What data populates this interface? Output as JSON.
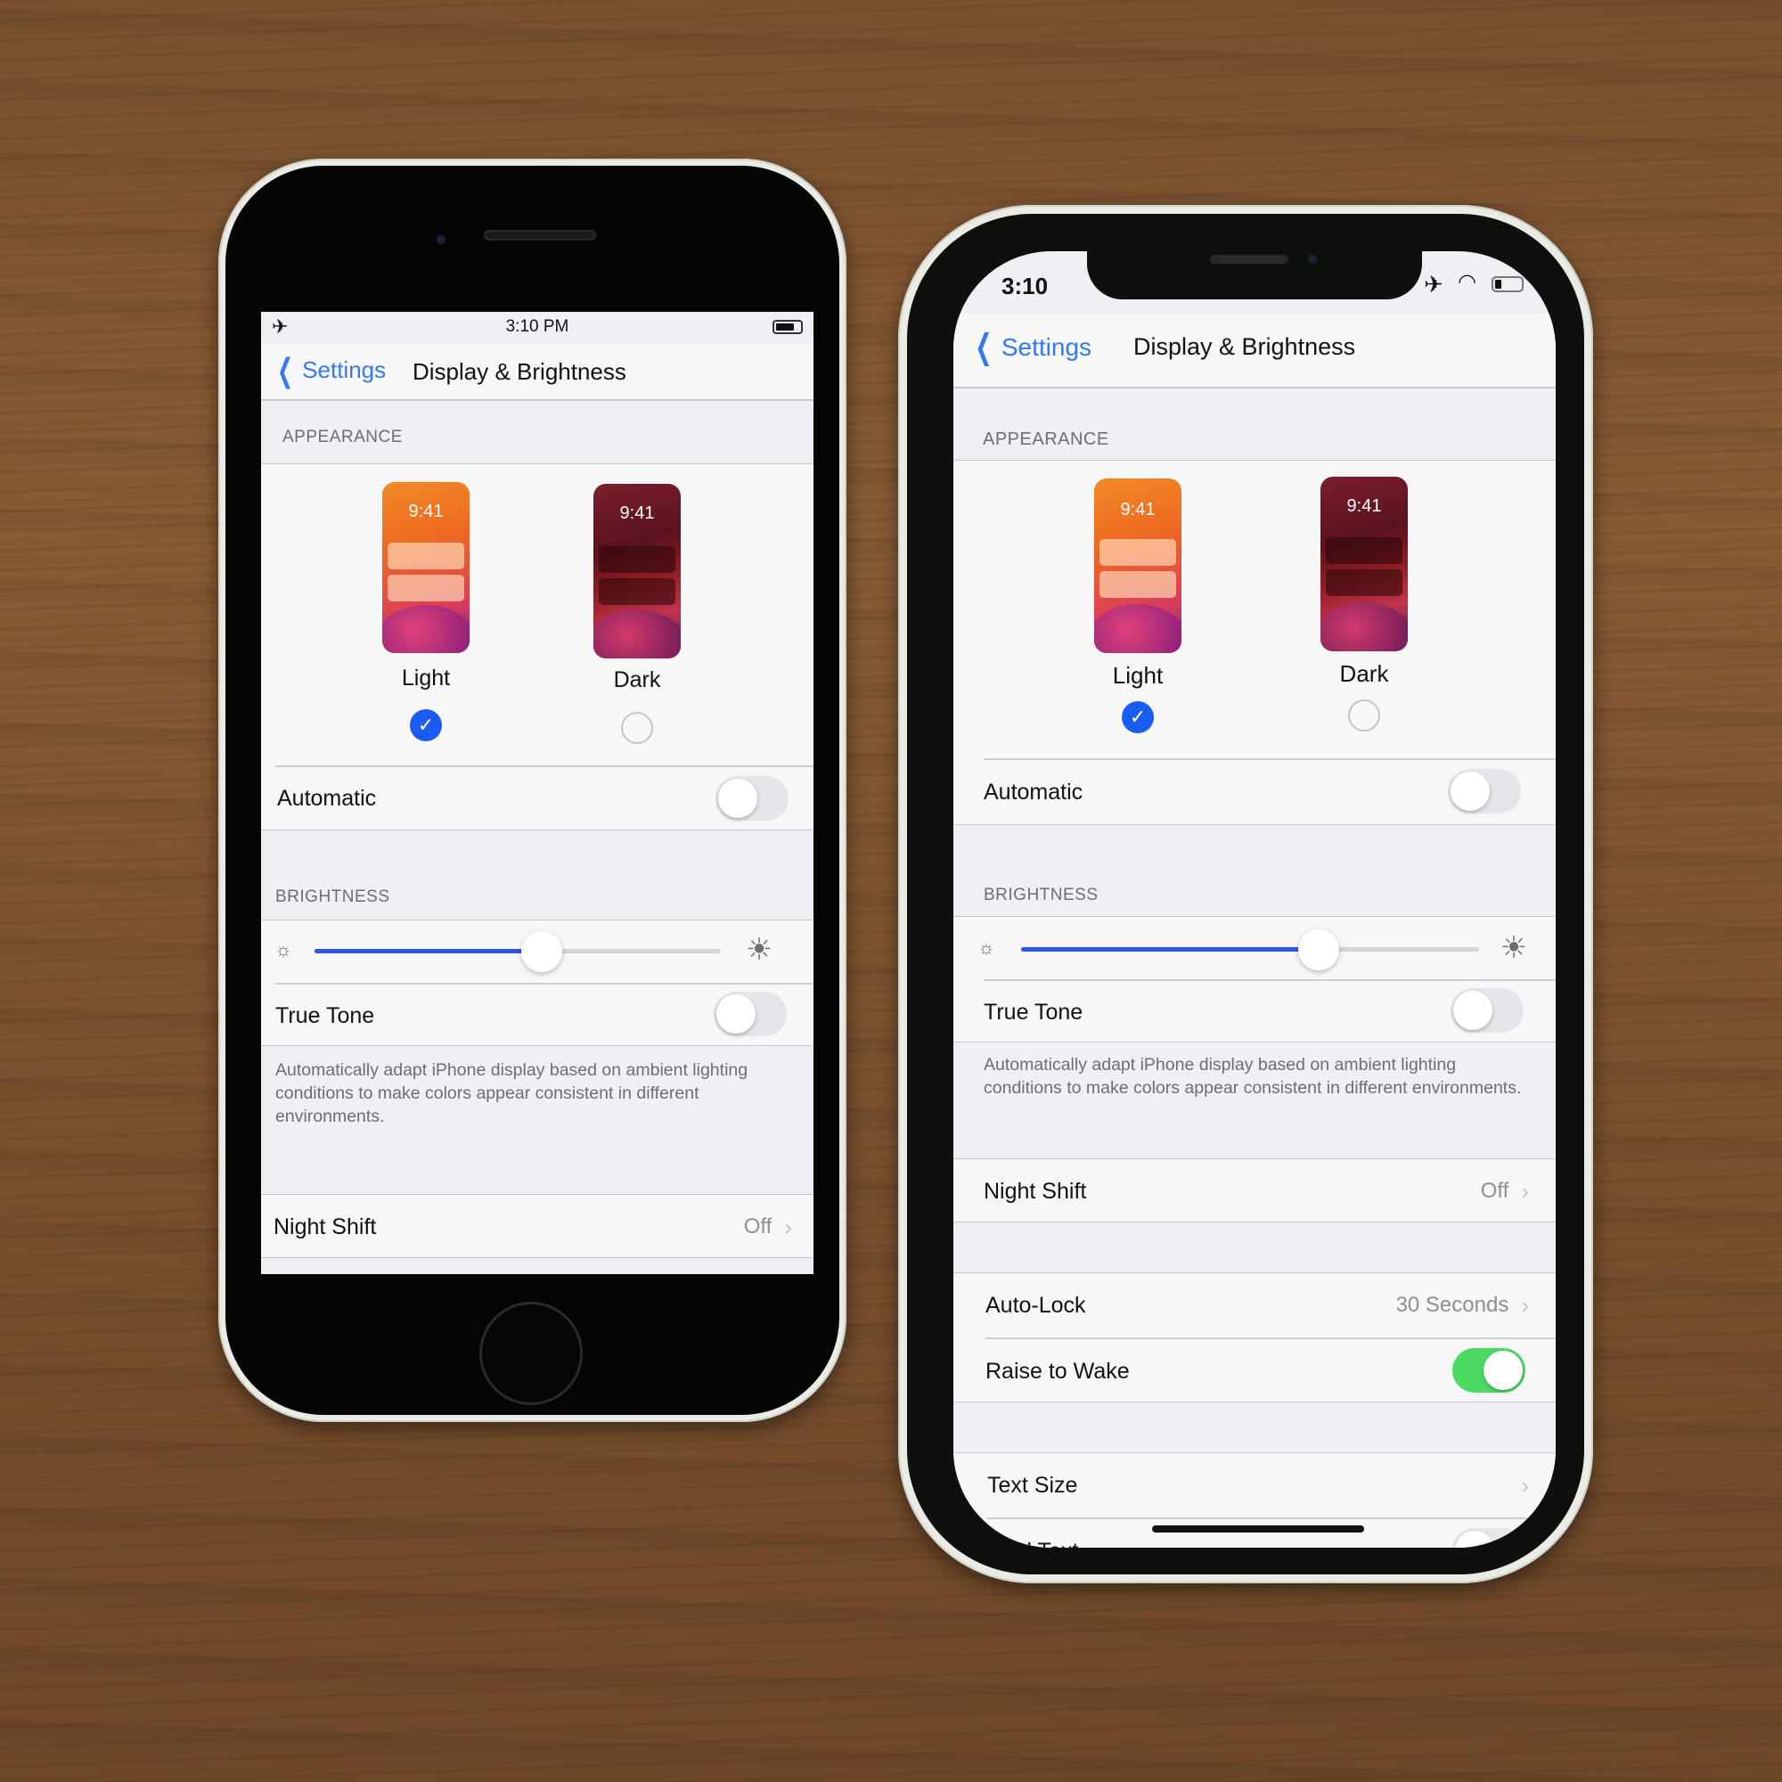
{
  "scene": "Two iPhones side by side on a wooden table showing Display & Brightness settings",
  "phones": {
    "left": {
      "model_style": "home-button",
      "status_bar": {
        "time": "3:10 PM",
        "left_icon": "airplane-icon",
        "right_icon": "battery-icon"
      },
      "nav": {
        "back_label": "Settings",
        "title": "Display & Brightness"
      },
      "appearance": {
        "header": "APPEARANCE",
        "options": [
          {
            "label": "Light",
            "thumb_time": "9:41",
            "selected": true
          },
          {
            "label": "Dark",
            "thumb_time": "9:41",
            "selected": false
          }
        ],
        "automatic": {
          "label": "Automatic",
          "on": false
        }
      },
      "brightness": {
        "header": "BRIGHTNESS",
        "level": 0.56,
        "true_tone": {
          "label": "True Tone",
          "on": false
        },
        "footnote": "Automatically adapt iPhone display based on ambient lighting conditions to make colors appear consistent in different environments."
      },
      "night_shift": {
        "label": "Night Shift",
        "value": "Off"
      }
    },
    "right": {
      "model_style": "notch",
      "status_bar": {
        "time": "3:10",
        "icons": [
          "airplane-icon",
          "wifi-icon",
          "battery-icon"
        ]
      },
      "nav": {
        "back_label": "Settings",
        "title": "Display & Brightness"
      },
      "appearance": {
        "header": "APPEARANCE",
        "options": [
          {
            "label": "Light",
            "thumb_time": "9:41",
            "selected": true
          },
          {
            "label": "Dark",
            "thumb_time": "9:41",
            "selected": false
          }
        ],
        "automatic": {
          "label": "Automatic",
          "on": false
        }
      },
      "brightness": {
        "header": "BRIGHTNESS",
        "level": 0.65,
        "true_tone": {
          "label": "True Tone",
          "on": false
        },
        "footnote": "Automatically adapt iPhone display based on ambient lighting conditions to make colors appear consistent in different environments."
      },
      "night_shift": {
        "label": "Night Shift",
        "value": "Off"
      },
      "auto_lock": {
        "label": "Auto-Lock",
        "value": "30 Seconds"
      },
      "raise_to_wake": {
        "label": "Raise to Wake",
        "on": true
      },
      "text_size": {
        "label": "Text Size"
      },
      "bold_text": {
        "label": "Bold Text",
        "on": false
      }
    }
  },
  "colors": {
    "accent_blue": "#3478f6",
    "check_blue": "#1a5cf0",
    "slider_blue": "#2f55e4",
    "toggle_green": "#4cd964"
  }
}
